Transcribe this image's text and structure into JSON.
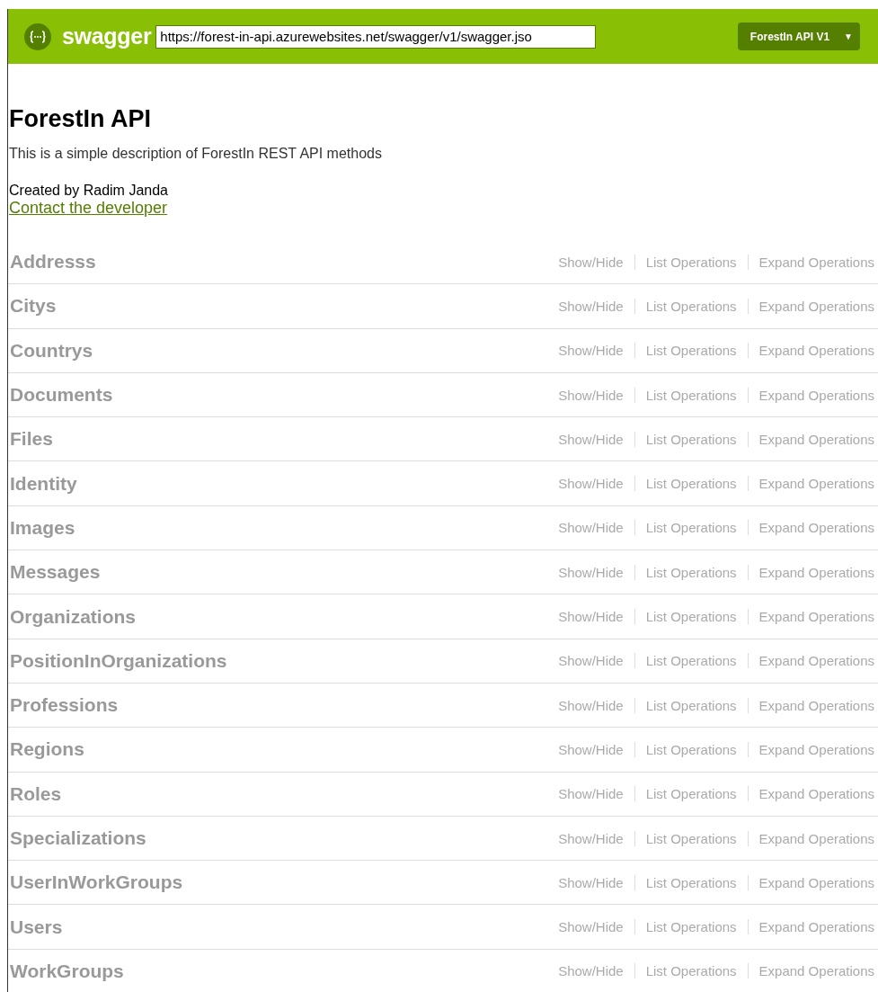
{
  "header": {
    "logo_text": "swagger",
    "url": "https://forest-in-api.azurewebsites.net/swagger/v1/swagger.jso",
    "spec_select": {
      "value": "ForestIn API V1",
      "caret": "▼"
    }
  },
  "info": {
    "title": "ForestIn API",
    "description": "This is a simple description of ForestIn REST API methods",
    "created_by": "Created by Radim Janda",
    "contact_link": "Contact the developer"
  },
  "resources": [
    {
      "name": "Addresss",
      "actions": [
        "Show/Hide",
        "List Operations",
        "Expand Operations"
      ]
    },
    {
      "name": "Citys",
      "actions": [
        "Show/Hide",
        "List Operations",
        "Expand Operations"
      ]
    },
    {
      "name": "Countrys",
      "actions": [
        "Show/Hide",
        "List Operations",
        "Expand Operations"
      ]
    },
    {
      "name": "Documents",
      "actions": [
        "Show/Hide",
        "List Operations",
        "Expand Operations"
      ]
    },
    {
      "name": "Files",
      "actions": [
        "Show/Hide",
        "List Operations",
        "Expand Operations"
      ]
    },
    {
      "name": "Identity",
      "actions": [
        "Show/Hide",
        "List Operations",
        "Expand Operations"
      ]
    },
    {
      "name": "Images",
      "actions": [
        "Show/Hide",
        "List Operations",
        "Expand Operations"
      ]
    },
    {
      "name": "Messages",
      "actions": [
        "Show/Hide",
        "List Operations",
        "Expand Operations"
      ]
    },
    {
      "name": "Organizations",
      "actions": [
        "Show/Hide",
        "List Operations",
        "Expand Operations"
      ]
    },
    {
      "name": "PositionInOrganizations",
      "actions": [
        "Show/Hide",
        "List Operations",
        "Expand Operations"
      ]
    },
    {
      "name": "Professions",
      "actions": [
        "Show/Hide",
        "List Operations",
        "Expand Operations"
      ]
    },
    {
      "name": "Regions",
      "actions": [
        "Show/Hide",
        "List Operations",
        "Expand Operations"
      ]
    },
    {
      "name": "Roles",
      "actions": [
        "Show/Hide",
        "List Operations",
        "Expand Operations"
      ]
    },
    {
      "name": "Specializations",
      "actions": [
        "Show/Hide",
        "List Operations",
        "Expand Operations"
      ]
    },
    {
      "name": "UserInWorkGroups",
      "actions": [
        "Show/Hide",
        "List Operations",
        "Expand Operations"
      ]
    },
    {
      "name": "Users",
      "actions": [
        "Show/Hide",
        "List Operations",
        "Expand Operations"
      ]
    },
    {
      "name": "WorkGroups",
      "actions": [
        "Show/Hide",
        "List Operations",
        "Expand Operations"
      ]
    }
  ]
}
